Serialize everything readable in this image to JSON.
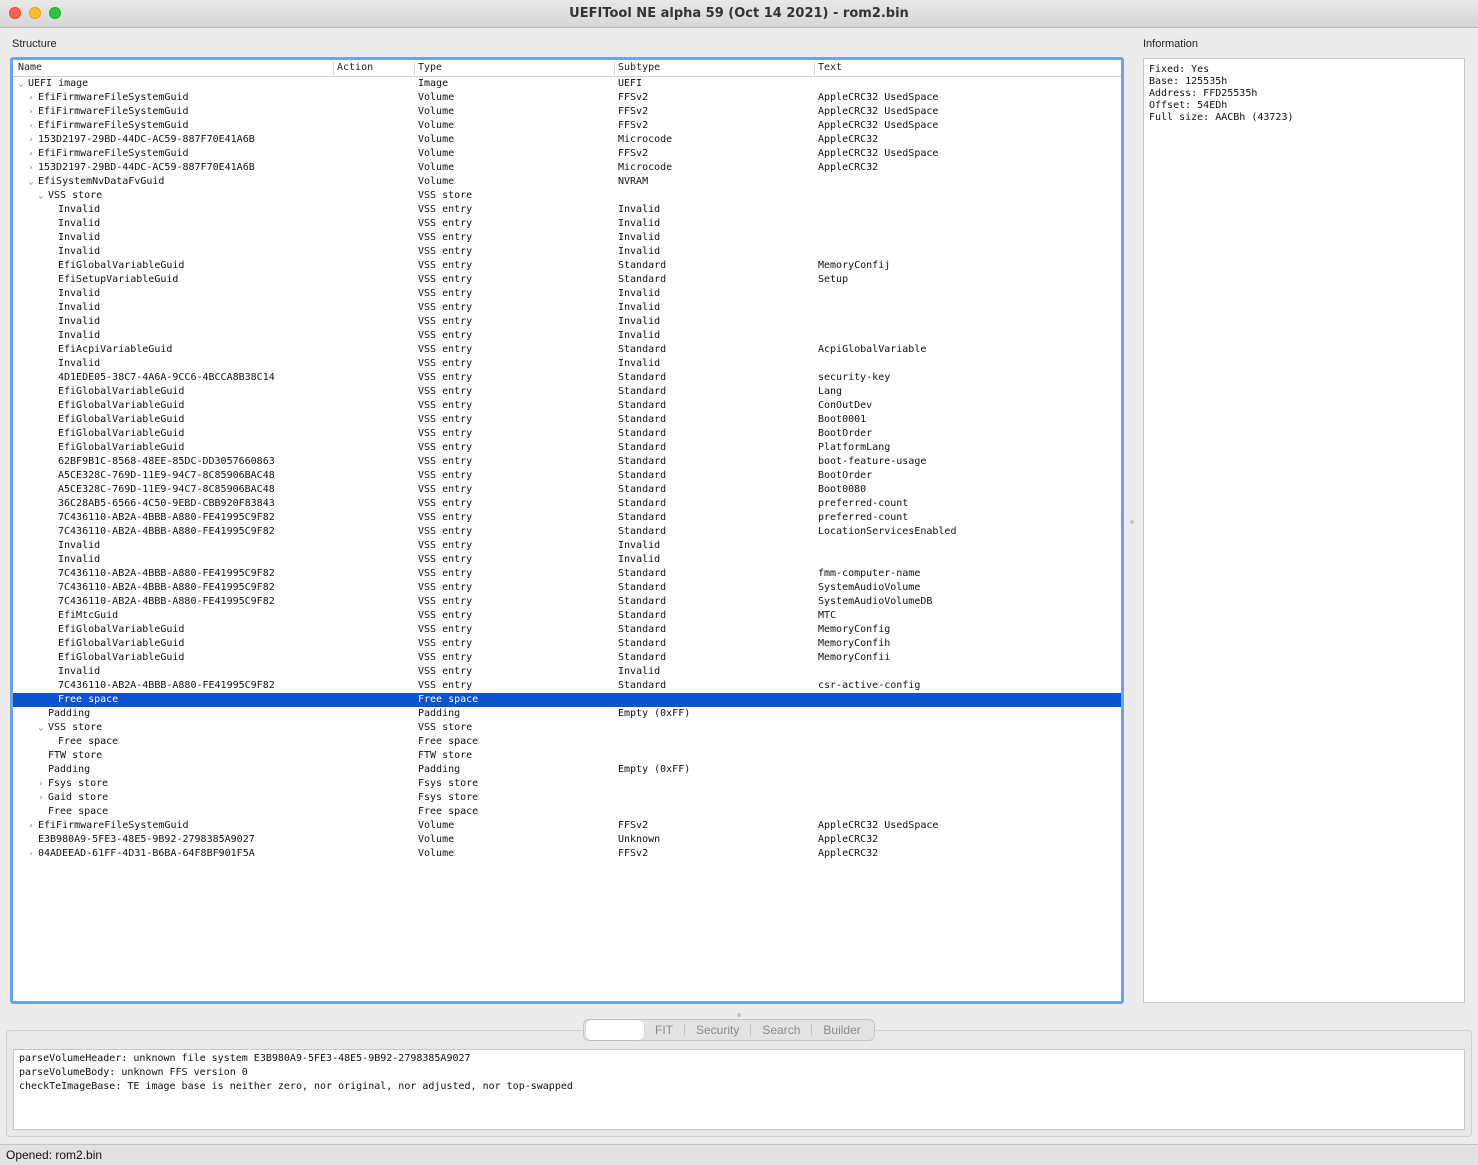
{
  "window": {
    "title": "UEFITool NE alpha 59 (Oct 14 2021) - rom2.bin"
  },
  "structure": {
    "label": "Structure",
    "columns": [
      "Name",
      "Action",
      "Type",
      "Subtype",
      "Text"
    ],
    "rows": [
      {
        "name": "UEFI image",
        "depth": 0,
        "expander": "open",
        "type": "Image",
        "subtype": "UEFI",
        "text": ""
      },
      {
        "name": "EfiFirmwareFileSystemGuid",
        "depth": 1,
        "expander": "closed",
        "type": "Volume",
        "subtype": "FFSv2",
        "text": "AppleCRC32 UsedSpace"
      },
      {
        "name": "EfiFirmwareFileSystemGuid",
        "depth": 1,
        "expander": "closed",
        "type": "Volume",
        "subtype": "FFSv2",
        "text": "AppleCRC32 UsedSpace"
      },
      {
        "name": "EfiFirmwareFileSystemGuid",
        "depth": 1,
        "expander": "closed",
        "type": "Volume",
        "subtype": "FFSv2",
        "text": "AppleCRC32 UsedSpace"
      },
      {
        "name": "153D2197-29BD-44DC-AC59-887F70E41A6B",
        "depth": 1,
        "expander": "closed",
        "type": "Volume",
        "subtype": "Microcode",
        "text": "AppleCRC32"
      },
      {
        "name": "EfiFirmwareFileSystemGuid",
        "depth": 1,
        "expander": "closed",
        "type": "Volume",
        "subtype": "FFSv2",
        "text": "AppleCRC32 UsedSpace"
      },
      {
        "name": "153D2197-29BD-44DC-AC59-887F70E41A6B",
        "depth": 1,
        "expander": "closed",
        "type": "Volume",
        "subtype": "Microcode",
        "text": "AppleCRC32"
      },
      {
        "name": "EfiSystemNvDataFvGuid",
        "depth": 1,
        "expander": "open",
        "type": "Volume",
        "subtype": "NVRAM",
        "text": ""
      },
      {
        "name": "VSS store",
        "depth": 2,
        "expander": "open",
        "type": "VSS store",
        "subtype": "",
        "text": ""
      },
      {
        "name": "Invalid",
        "depth": 3,
        "expander": "",
        "type": "VSS entry",
        "subtype": "Invalid",
        "text": ""
      },
      {
        "name": "Invalid",
        "depth": 3,
        "expander": "",
        "type": "VSS entry",
        "subtype": "Invalid",
        "text": ""
      },
      {
        "name": "Invalid",
        "depth": 3,
        "expander": "",
        "type": "VSS entry",
        "subtype": "Invalid",
        "text": ""
      },
      {
        "name": "Invalid",
        "depth": 3,
        "expander": "",
        "type": "VSS entry",
        "subtype": "Invalid",
        "text": ""
      },
      {
        "name": "EfiGlobalVariableGuid",
        "depth": 3,
        "expander": "",
        "type": "VSS entry",
        "subtype": "Standard",
        "text": "MemoryConfij"
      },
      {
        "name": "EfiSetupVariableGuid",
        "depth": 3,
        "expander": "",
        "type": "VSS entry",
        "subtype": "Standard",
        "text": "Setup"
      },
      {
        "name": "Invalid",
        "depth": 3,
        "expander": "",
        "type": "VSS entry",
        "subtype": "Invalid",
        "text": ""
      },
      {
        "name": "Invalid",
        "depth": 3,
        "expander": "",
        "type": "VSS entry",
        "subtype": "Invalid",
        "text": ""
      },
      {
        "name": "Invalid",
        "depth": 3,
        "expander": "",
        "type": "VSS entry",
        "subtype": "Invalid",
        "text": ""
      },
      {
        "name": "Invalid",
        "depth": 3,
        "expander": "",
        "type": "VSS entry",
        "subtype": "Invalid",
        "text": ""
      },
      {
        "name": "EfiAcpiVariableGuid",
        "depth": 3,
        "expander": "",
        "type": "VSS entry",
        "subtype": "Standard",
        "text": "AcpiGlobalVariable"
      },
      {
        "name": "Invalid",
        "depth": 3,
        "expander": "",
        "type": "VSS entry",
        "subtype": "Invalid",
        "text": ""
      },
      {
        "name": "4D1EDE05-38C7-4A6A-9CC6-4BCCA8B38C14",
        "depth": 3,
        "expander": "",
        "type": "VSS entry",
        "subtype": "Standard",
        "text": "security-key"
      },
      {
        "name": "EfiGlobalVariableGuid",
        "depth": 3,
        "expander": "",
        "type": "VSS entry",
        "subtype": "Standard",
        "text": "Lang"
      },
      {
        "name": "EfiGlobalVariableGuid",
        "depth": 3,
        "expander": "",
        "type": "VSS entry",
        "subtype": "Standard",
        "text": "ConOutDev"
      },
      {
        "name": "EfiGlobalVariableGuid",
        "depth": 3,
        "expander": "",
        "type": "VSS entry",
        "subtype": "Standard",
        "text": "Boot0001"
      },
      {
        "name": "EfiGlobalVariableGuid",
        "depth": 3,
        "expander": "",
        "type": "VSS entry",
        "subtype": "Standard",
        "text": "BootOrder"
      },
      {
        "name": "EfiGlobalVariableGuid",
        "depth": 3,
        "expander": "",
        "type": "VSS entry",
        "subtype": "Standard",
        "text": "PlatformLang"
      },
      {
        "name": "62BF9B1C-8568-48EE-85DC-DD3057660863",
        "depth": 3,
        "expander": "",
        "type": "VSS entry",
        "subtype": "Standard",
        "text": "boot-feature-usage"
      },
      {
        "name": "A5CE328C-769D-11E9-94C7-8C85906BAC48",
        "depth": 3,
        "expander": "",
        "type": "VSS entry",
        "subtype": "Standard",
        "text": "BootOrder"
      },
      {
        "name": "A5CE328C-769D-11E9-94C7-8C85906BAC48",
        "depth": 3,
        "expander": "",
        "type": "VSS entry",
        "subtype": "Standard",
        "text": "Boot0080"
      },
      {
        "name": "36C28AB5-6566-4C50-9EBD-CBB920F83843",
        "depth": 3,
        "expander": "",
        "type": "VSS entry",
        "subtype": "Standard",
        "text": "preferred-count"
      },
      {
        "name": "7C436110-AB2A-4BBB-A880-FE41995C9F82",
        "depth": 3,
        "expander": "",
        "type": "VSS entry",
        "subtype": "Standard",
        "text": "preferred-count"
      },
      {
        "name": "7C436110-AB2A-4BBB-A880-FE41995C9F82",
        "depth": 3,
        "expander": "",
        "type": "VSS entry",
        "subtype": "Standard",
        "text": "LocationServicesEnabled"
      },
      {
        "name": "Invalid",
        "depth": 3,
        "expander": "",
        "type": "VSS entry",
        "subtype": "Invalid",
        "text": ""
      },
      {
        "name": "Invalid",
        "depth": 3,
        "expander": "",
        "type": "VSS entry",
        "subtype": "Invalid",
        "text": ""
      },
      {
        "name": "7C436110-AB2A-4BBB-A880-FE41995C9F82",
        "depth": 3,
        "expander": "",
        "type": "VSS entry",
        "subtype": "Standard",
        "text": "fmm-computer-name"
      },
      {
        "name": "7C436110-AB2A-4BBB-A880-FE41995C9F82",
        "depth": 3,
        "expander": "",
        "type": "VSS entry",
        "subtype": "Standard",
        "text": "SystemAudioVolume"
      },
      {
        "name": "7C436110-AB2A-4BBB-A880-FE41995C9F82",
        "depth": 3,
        "expander": "",
        "type": "VSS entry",
        "subtype": "Standard",
        "text": "SystemAudioVolumeDB"
      },
      {
        "name": "EfiMtcGuid",
        "depth": 3,
        "expander": "",
        "type": "VSS entry",
        "subtype": "Standard",
        "text": "MTC"
      },
      {
        "name": "EfiGlobalVariableGuid",
        "depth": 3,
        "expander": "",
        "type": "VSS entry",
        "subtype": "Standard",
        "text": "MemoryConfig"
      },
      {
        "name": "EfiGlobalVariableGuid",
        "depth": 3,
        "expander": "",
        "type": "VSS entry",
        "subtype": "Standard",
        "text": "MemoryConfih"
      },
      {
        "name": "EfiGlobalVariableGuid",
        "depth": 3,
        "expander": "",
        "type": "VSS entry",
        "subtype": "Standard",
        "text": "MemoryConfii"
      },
      {
        "name": "Invalid",
        "depth": 3,
        "expander": "",
        "type": "VSS entry",
        "subtype": "Invalid",
        "text": ""
      },
      {
        "name": "7C436110-AB2A-4BBB-A880-FE41995C9F82",
        "depth": 3,
        "expander": "",
        "type": "VSS entry",
        "subtype": "Standard",
        "text": "csr-active-config"
      },
      {
        "name": "Free space",
        "depth": 3,
        "expander": "",
        "type": "Free space",
        "subtype": "",
        "text": "",
        "selected": true
      },
      {
        "name": "Padding",
        "depth": 2,
        "expander": "",
        "type": "Padding",
        "subtype": "Empty (0xFF)",
        "text": ""
      },
      {
        "name": "VSS store",
        "depth": 2,
        "expander": "open",
        "type": "VSS store",
        "subtype": "",
        "text": ""
      },
      {
        "name": "Free space",
        "depth": 3,
        "expander": "",
        "type": "Free space",
        "subtype": "",
        "text": ""
      },
      {
        "name": "FTW store",
        "depth": 2,
        "expander": "",
        "type": "FTW store",
        "subtype": "",
        "text": ""
      },
      {
        "name": "Padding",
        "depth": 2,
        "expander": "",
        "type": "Padding",
        "subtype": "Empty (0xFF)",
        "text": ""
      },
      {
        "name": "Fsys store",
        "depth": 2,
        "expander": "closed",
        "type": "Fsys store",
        "subtype": "",
        "text": ""
      },
      {
        "name": "Gaid store",
        "depth": 2,
        "expander": "closed",
        "type": "Fsys store",
        "subtype": "",
        "text": ""
      },
      {
        "name": "Free space",
        "depth": 2,
        "expander": "",
        "type": "Free space",
        "subtype": "",
        "text": ""
      },
      {
        "name": "EfiFirmwareFileSystemGuid",
        "depth": 1,
        "expander": "closed",
        "type": "Volume",
        "subtype": "FFSv2",
        "text": "AppleCRC32 UsedSpace"
      },
      {
        "name": "E3B980A9-5FE3-48E5-9B92-2798385A9027",
        "depth": 1,
        "expander": "",
        "type": "Volume",
        "subtype": "Unknown",
        "text": "AppleCRC32"
      },
      {
        "name": "04ADEEAD-61FF-4D31-B6BA-64F8BF901F5A",
        "depth": 1,
        "expander": "closed",
        "type": "Volume",
        "subtype": "FFSv2",
        "text": "AppleCRC32"
      }
    ]
  },
  "information": {
    "label": "Information",
    "lines": [
      "Fixed: Yes",
      "Base: 125535h",
      "Address: FFD25535h",
      "Offset: 54EDh",
      "Full size: AACBh (43723)"
    ]
  },
  "tabs": {
    "items": [
      {
        "label": "",
        "active": true
      },
      {
        "label": "FIT",
        "active": false
      },
      {
        "label": "Security",
        "active": false
      },
      {
        "label": "Search",
        "active": false
      },
      {
        "label": "Builder",
        "active": false
      }
    ]
  },
  "messages": [
    "parseVolumeHeader: unknown file system E3B980A9-5FE3-48E5-9B92-2798385A9027",
    "parseVolumeBody: unknown FFS version 0",
    "checkTeImageBase: TE image base is neither zero, nor original, nor adjusted, nor top-swapped"
  ],
  "status": {
    "text": "Opened: rom2.bin"
  },
  "colors": {
    "selection": "#0a52cf",
    "focus_ring": "#6aa4f0"
  }
}
